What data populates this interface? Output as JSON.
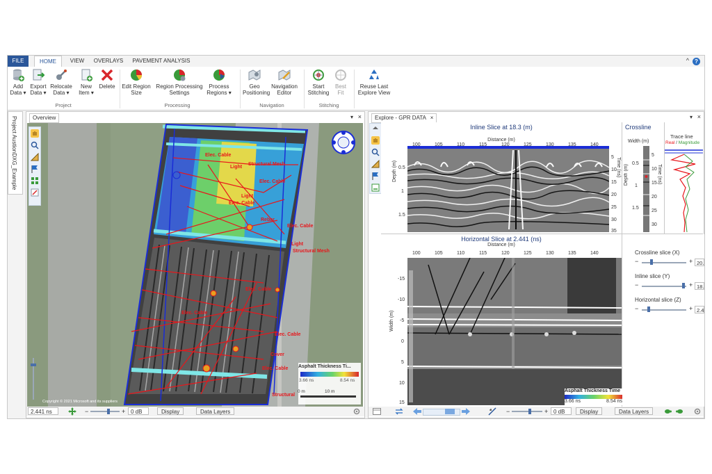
{
  "ribbon_tabs": {
    "file": "FILE",
    "home": "HOME",
    "view": "VIEW",
    "overlays": "OVERLAYS",
    "pavement": "PAVEMENT ANALYSIS"
  },
  "window": {
    "collapse": "^",
    "help": "?"
  },
  "ribbon": {
    "add_data": "Add\nData ▾",
    "export_data": "Export\nData ▾",
    "relocate_data": "Relocate\nData ▾",
    "new_item": "New\nItem ▾",
    "delete": "Delete",
    "edit_region_size": "Edit Region\nSize",
    "region_processing_settings": "Region Processing\nSettings",
    "process_regions": "Process\nRegions ▾",
    "geo_positioning": "Geo\nPositioning",
    "navigation_editor": "Navigation\nEditor",
    "start_stitching": "Start\nStitching",
    "best_fit": "Best\nFit",
    "reuse_last_explore_view": "Reuse Last\nExplore View",
    "groups": {
      "project": "Project",
      "processing": "Processing",
      "navigation": "Navigation",
      "stitching": "Stitching"
    }
  },
  "sidebar": {
    "project_label": "Project AustionDXG_Example"
  },
  "overview": {
    "tab": "Overview",
    "copyright": "Copyright © 2021 Microsoft and its suppliers",
    "legend_title": "Asphalt Thickness Ti...",
    "legend_min": "3.66 ns",
    "legend_max": "8.54 ns",
    "scale_zero": "0 m",
    "scale_ten": "10 m",
    "labels": [
      "Structural Mesh",
      "Elec. Cable",
      "Light",
      "Elec. Cable",
      "Light",
      "Elec. Cable",
      "Rebar",
      "Elec. Cable",
      "Light",
      "Structural Mesh",
      "Elec. Cable",
      "Elec. Cable",
      "Elec. Cable",
      "Cover",
      "Elec. Cable",
      "Structural"
    ],
    "status": {
      "time": "2.441 ns",
      "gain": "0 dB",
      "display": "Display",
      "data_layers": "Data Layers"
    }
  },
  "explore": {
    "tab": "Explore - GPR DATA",
    "inline_title": "Inline Slice at 18.3 (m)",
    "crossline_title": "Crossline",
    "trace_title": "Trace line",
    "trace_real": "Real",
    "trace_sep": " / ",
    "trace_mag": "Magnitude",
    "distance_label": "Distance (m)",
    "depth_label": "Depth (m)",
    "time_label": "Time (ns)",
    "width_label": "Width (m)",
    "horizontal_title": "Horizontal Slice at 2.441 (ns)",
    "width_label_h": "Width (m)",
    "distance_ticks": [
      "100",
      "105",
      "110",
      "115",
      "120",
      "125",
      "130",
      "135",
      "140"
    ],
    "depth_ticks": [
      "0.5",
      "1",
      "1.5"
    ],
    "time_ticks": [
      "5",
      "10",
      "15",
      "20",
      "25",
      "30",
      "35"
    ],
    "crossline_depth_ticks": [
      "0.5",
      "1",
      "1.5"
    ],
    "crossline_time_ticks": [
      "5",
      "10",
      "15",
      "20",
      "25",
      "30"
    ],
    "width_ticks": [
      "-15",
      "-10",
      "-5",
      "0",
      "5",
      "10",
      "15"
    ],
    "legend_title": "Asphalt Thickness Time",
    "legend_min": "3.66 ns",
    "legend_max": "8.54 ns",
    "crossline_slice": "Crossline slice (X)",
    "crossline_value": "20.",
    "inline_slice": "Inline slice (Y)",
    "inline_value": "18.",
    "horizontal_slice": "Horizontal slice (Z)",
    "horizontal_value": "2.4",
    "minus": "−",
    "plus": "+",
    "status": {
      "gain": "0 dB",
      "display": "Display",
      "data_layers": "Data Layers"
    }
  },
  "colors": {
    "accent": "#2b579a",
    "title_blue": "#1f3a7a",
    "annotation_red": "#e8161b",
    "outline_blue": "#1a2dd6"
  }
}
